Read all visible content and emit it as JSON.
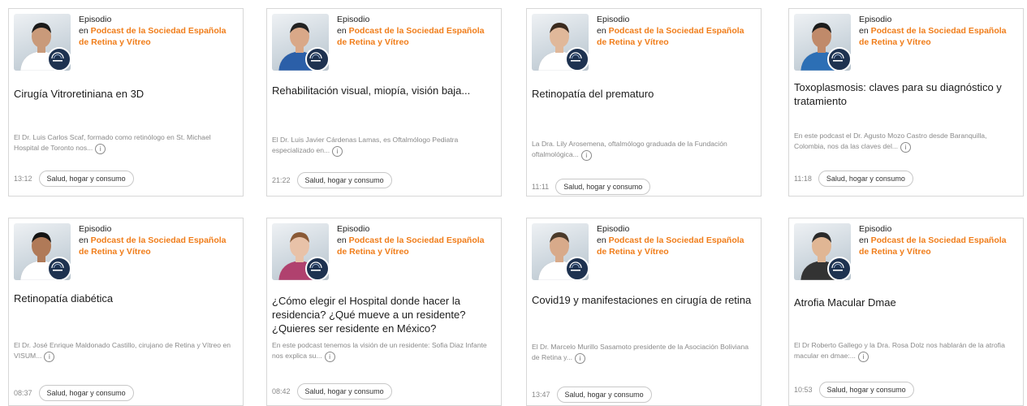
{
  "labels": {
    "kind": "Episodio",
    "en": "en"
  },
  "icons": {
    "logo": "seorv-logo-icon",
    "info": "info-icon"
  },
  "colors": {
    "accent": "#f07d1a",
    "badge": "#1e3250"
  },
  "cards": [
    {
      "podcast": "Podcast de la Sociedad Española de Retina y Vítreo",
      "title": "Cirugía Vitroretiniana en 3D",
      "description": "El Dr. Luis Carlos Scaf, formado como retinólogo en St. Michael Hospital de Toronto nos...",
      "duration": "13:12",
      "category": "Salud, hogar y consumo"
    },
    {
      "podcast": "Podcast de la Sociedad Española de Retina y Vítreo",
      "title": "Rehabilitación visual, miopía, visión baja...",
      "description": "El Dr. Luis Javier Cárdenas Lamas, es Oftalmólogo Pediatra especializado en...",
      "duration": "21:22",
      "category": "Salud, hogar y consumo"
    },
    {
      "podcast": "Podcast de la Sociedad Española de Retina y Vítreo",
      "title": "Retinopatía del prematuro",
      "description": "La Dra. Lily Arosemena, oftalmólogo graduada de la Fundación oftalmológica...",
      "duration": "11:11",
      "category": "Salud, hogar y consumo"
    },
    {
      "podcast": "Podcast de la Sociedad Española de Retina y Vítreo",
      "title": "Toxoplasmosis: claves para su diagnóstico y tratamiento",
      "description": "En este podcast el Dr. Agusto Mozo Castro desde Baranquilla, Colombia, nos da las claves del...",
      "duration": "11:18",
      "category": "Salud, hogar y consumo"
    },
    {
      "podcast": "Podcast de la Sociedad Española de Retina y Vítreo",
      "title": "Retinopatía diabética",
      "description": "El Dr. José Enrique Maldonado Castillo, cirujano de Retina y Vítreo en VISUM...",
      "duration": "08:37",
      "category": "Salud, hogar y consumo"
    },
    {
      "podcast": "Podcast de la Sociedad Española de Retina y Vítreo",
      "title": "¿Cómo elegir el Hospital donde hacer la residencia? ¿Qué mueve a un residente? ¿Quieres ser residente en México?",
      "description": "En este podcast tenemos la visión de un residente: Sofia Diaz Infante nos explica su...",
      "duration": "08:42",
      "category": "Salud, hogar y consumo"
    },
    {
      "podcast": "Podcast de la Sociedad Española de Retina y Vítreo",
      "title": "Covid19 y manifestaciones en cirugía de retina",
      "description": "El Dr. Marcelo Murillo Sasamoto presidente de la Asociación Boliviana de Retina y...",
      "duration": "13:47",
      "category": "Salud, hogar y consumo"
    },
    {
      "podcast": "Podcast de la Sociedad Española de Retina y Vítreo",
      "title": "Atrofia Macular Dmae",
      "description": "El Dr Roberto Gallego y la Dra. Rosa Dolz nos hablarán de la atrofia macular en dmae:...",
      "duration": "10:53",
      "category": "Salud, hogar y consumo"
    }
  ]
}
